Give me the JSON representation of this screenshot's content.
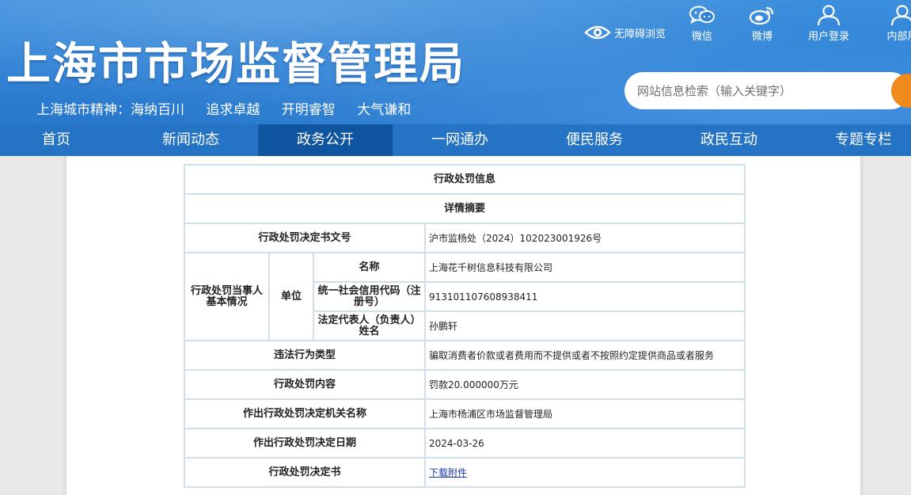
{
  "header": {
    "site_title": "上海市市场监督管理局",
    "slogan": [
      "上海城市精神：海纳百川",
      "追求卓越",
      "开明睿智",
      "大气谦和"
    ],
    "accessibility": {
      "icon": "eye-icon",
      "label": "无障碍浏览"
    },
    "top_icons": [
      {
        "icon": "wechat-icon",
        "label": "微信"
      },
      {
        "icon": "weibo-icon",
        "label": "微博"
      },
      {
        "icon": "user-icon",
        "label": "用户登录"
      },
      {
        "icon": "user-icon",
        "label": "内部用"
      }
    ],
    "search": {
      "placeholder": "网站信息检索（输入关键字）",
      "button_color": "#f08a1d"
    }
  },
  "nav": {
    "items": [
      "首页",
      "新闻动态",
      "政务公开",
      "一网通办",
      "便民服务",
      "政民互动",
      "专题专栏"
    ],
    "active": "政务公开"
  },
  "record": {
    "title": "行政处罚信息",
    "subtitle": "详情摘要",
    "doc_no_label": "行政处罚决定书文号",
    "doc_no": "沪市监杨处（2024）102023001926号",
    "party_label": "行政处罚当事人基本情况",
    "unit_label": "单位",
    "name_label": "名称",
    "name": "上海花千树信息科技有限公司",
    "credit_code_label": "统一社会信用代码（注册号）",
    "credit_code": "913101107608938411",
    "legal_rep_label": "法定代表人（负责人）姓名",
    "legal_rep": "孙鹏轩",
    "violation_type_label": "违法行为类型",
    "violation_type": "骗取消费者价款或者费用而不提供或者不按照约定提供商品或者服务",
    "penalty_label": "行政处罚内容",
    "penalty": "罚款20.000000万元",
    "authority_label": "作出行政处罚决定机关名称",
    "authority": "上海市杨浦区市场监督管理局",
    "date_label": "作出行政处罚决定日期",
    "date": "2024-03-26",
    "decision_label": "行政处罚决定书",
    "decision_link": "下载附件"
  },
  "colors": {
    "header_blue": "#2f82d6",
    "nav_blue": "#2573c4",
    "nav_active": "#0f559f",
    "table_border": "#cfe0ec"
  }
}
